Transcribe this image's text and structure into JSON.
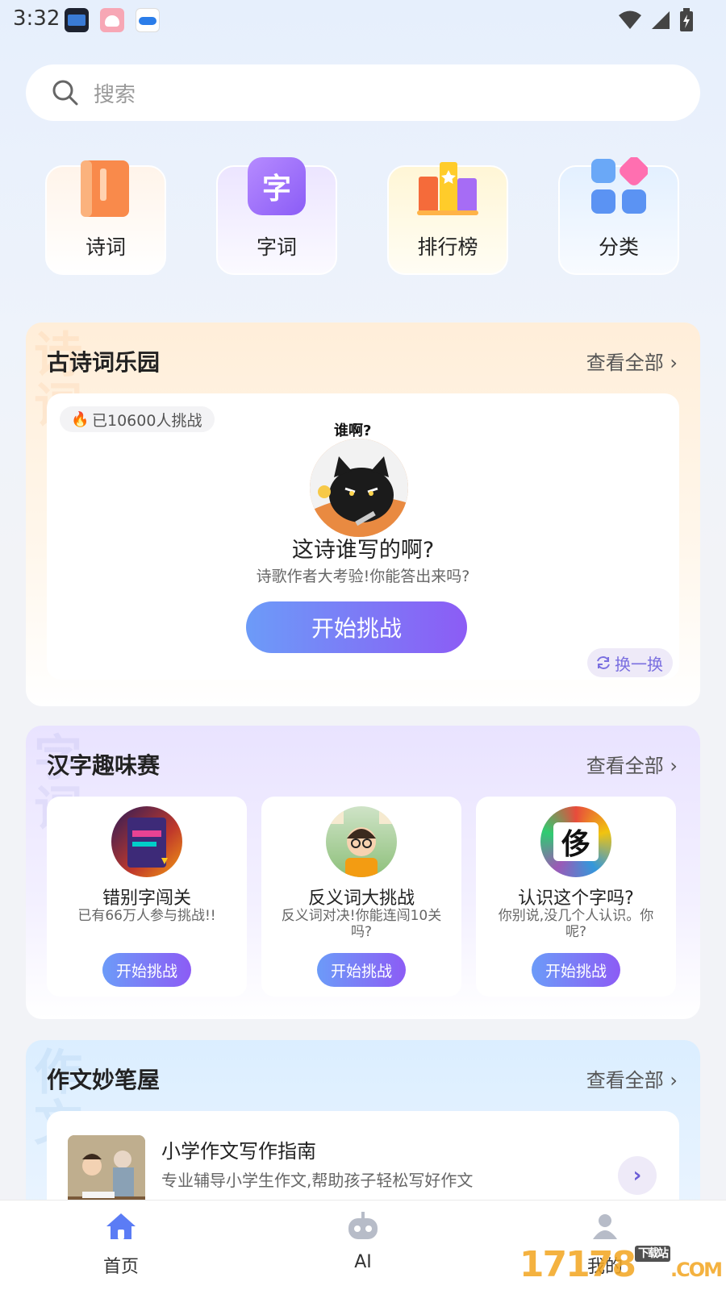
{
  "status_bar": {
    "time": "3:32"
  },
  "search": {
    "placeholder": "搜索"
  },
  "categories": [
    {
      "label": "诗词"
    },
    {
      "label": "字词",
      "icon_text": "字"
    },
    {
      "label": "排行榜"
    },
    {
      "label": "分类"
    }
  ],
  "poetry_section": {
    "title": "古诗词乐园",
    "more": "查看全部",
    "ghost": "诗\n词",
    "challenge": {
      "badge": "已10600人挑战",
      "bubble": "谁啊?",
      "title": "这诗谁写的啊?",
      "subtitle": "诗歌作者大考验!你能答出来吗?",
      "button": "开始挑战",
      "swap": "换一换"
    }
  },
  "hanzi_section": {
    "title": "汉字趣味赛",
    "more": "查看全部",
    "ghost": "字\n词",
    "games": [
      {
        "title": "错别字闯关",
        "subtitle": "已有66万人参与挑战!!",
        "button": "开始挑战"
      },
      {
        "title": "反义词大挑战",
        "subtitle": "反义词对决!你能连闯10关吗?",
        "button": "开始挑战"
      },
      {
        "title": "认识这个字吗?",
        "subtitle": "你别说,没几个人认识。你呢?",
        "button": "开始挑战",
        "avatar_text": "侈"
      }
    ]
  },
  "essay_section": {
    "title": "作文妙笔屋",
    "more": "查看全部",
    "ghost": "作\n文",
    "item": {
      "title": "小学作文写作指南",
      "subtitle": "专业辅导小学生作文,帮助孩子轻松写好作文"
    }
  },
  "bottom_nav": [
    {
      "label": "首页",
      "icon": "home-icon",
      "active": true
    },
    {
      "label": "AI",
      "icon": "robot-icon"
    },
    {
      "label": "我的",
      "icon": "user-icon"
    }
  ],
  "watermark": {
    "text": "17178",
    "tag": "下载站",
    "suffix": ".COM"
  },
  "colors": {
    "accent_start": "#6c9bf8",
    "accent_end": "#8c5cf5",
    "active_nav": "#5b7cf5"
  }
}
